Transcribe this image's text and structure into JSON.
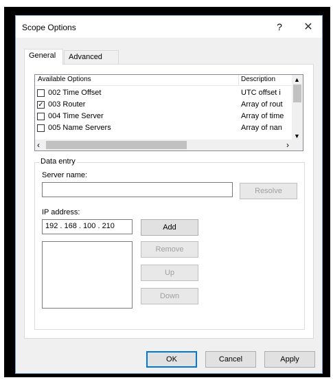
{
  "window": {
    "title": "Scope Options",
    "help_glyph": "?",
    "close_glyph": "✕"
  },
  "tabs": [
    {
      "label": "General",
      "active": true
    },
    {
      "label": "Advanced",
      "active": false
    }
  ],
  "options_list": {
    "header_col1": "Available Options",
    "header_col2": "Description",
    "rows": [
      {
        "name": "002 Time Offset",
        "description": "UTC offset i",
        "checked": false
      },
      {
        "name": "003 Router",
        "description": "Array of rout",
        "checked": true
      },
      {
        "name": "004 Time Server",
        "description": "Array of time",
        "checked": false
      },
      {
        "name": "005 Name Servers",
        "description": "Array of nan",
        "checked": false
      }
    ]
  },
  "data_entry": {
    "group_label": "Data entry",
    "server_name_label": "Server name:",
    "server_name_value": "",
    "resolve_label": "Resolve",
    "ip_label": "IP address:",
    "ip_value": "192 . 168 . 100 . 210",
    "add_label": "Add",
    "remove_label": "Remove",
    "up_label": "Up",
    "down_label": "Down"
  },
  "footer": {
    "ok_label": "OK",
    "cancel_label": "Cancel",
    "apply_label": "Apply"
  }
}
